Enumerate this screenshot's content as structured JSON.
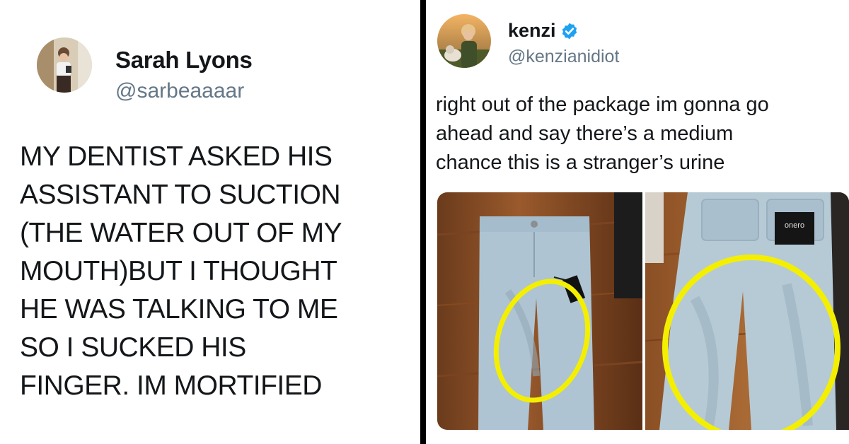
{
  "left_tweet": {
    "name": "Sarah Lyons",
    "handle": "@sarbeaaaar",
    "text": "MY DENTIST ASKED HIS\nASSISTANT TO SUCTION\n(THE WATER OUT OF MY\nMOUTH)BUT I THOUGHT\nHE WAS TALKING TO ME\nSO I SUCKED HIS\nFINGER. IM MORTIFIED",
    "avatar_icon": "profile-photo"
  },
  "right_tweet": {
    "name": "kenzi",
    "verified": true,
    "handle": "@kenzianidiot",
    "text": "right out of the package im gonna go\nahead and say there’s a medium\nchance this is a stranger’s urine",
    "avatar_icon": "profile-photo",
    "photos": [
      {
        "subject": "jeans-front",
        "tag_text": ""
      },
      {
        "subject": "jeans-back",
        "tag_text": "onero"
      }
    ]
  },
  "colors": {
    "text": "#14171a",
    "handle": "#657786",
    "verified": "#1da1f2",
    "highlight": "#f4ef00",
    "divider": "#000000"
  }
}
